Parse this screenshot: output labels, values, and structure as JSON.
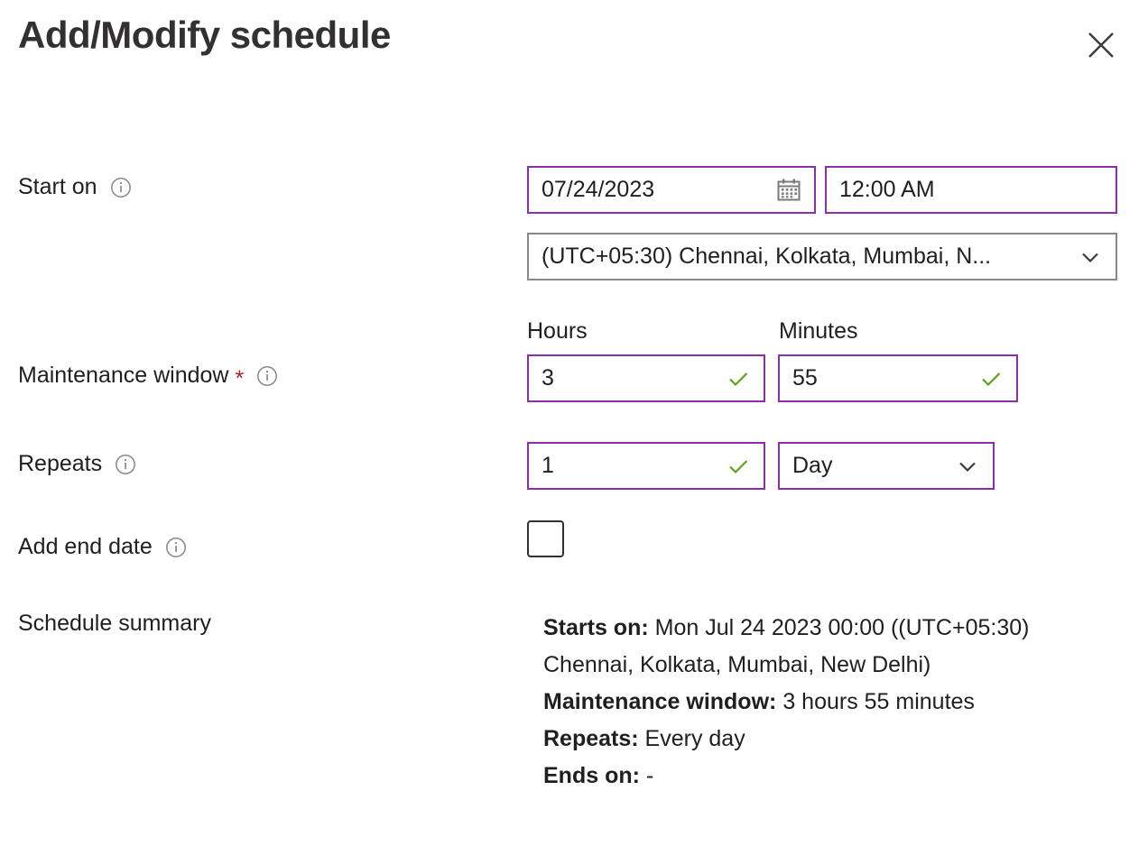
{
  "panel": {
    "title": "Add/Modify schedule",
    "close_label": "Close",
    "close_icon": "close-icon"
  },
  "form": {
    "start_on": {
      "label": "Start on",
      "info_icon": "info-icon",
      "date_value": "07/24/2023",
      "date_icon": "calendar-icon",
      "time_value": "12:00 AM",
      "timezone_value": "(UTC+05:30) Chennai, Kolkata, Mumbai, N...",
      "timezone_chevron": "chevron-down-icon"
    },
    "maintenance_window": {
      "label": "Maintenance window",
      "required_marker": "*",
      "info_icon": "info-icon",
      "hours_label": "Hours",
      "hours_value": "3",
      "hours_valid_icon": "check-icon",
      "minutes_label": "Minutes",
      "minutes_value": "55",
      "minutes_valid_icon": "check-icon"
    },
    "repeats": {
      "label": "Repeats",
      "info_icon": "info-icon",
      "interval_value": "1",
      "interval_valid_icon": "check-icon",
      "unit_value": "Day",
      "unit_chevron": "chevron-down-icon"
    },
    "add_end_date": {
      "label": "Add end date",
      "info_icon": "info-icon",
      "checked": false
    },
    "schedule_summary": {
      "label": "Schedule summary",
      "lines": [
        {
          "key": "Starts on:",
          "value": "Mon Jul 24 2023 00:00 ((UTC+05:30) Chennai, Kolkata, Mumbai, New Delhi)"
        },
        {
          "key": "Maintenance window:",
          "value": "3 hours 55 minutes"
        },
        {
          "key": "Repeats:",
          "value": "Every day"
        },
        {
          "key": "Ends on:",
          "value": "-"
        }
      ]
    }
  },
  "colors": {
    "accent_purple": "#8b2fa8",
    "neutral_border": "#8a8886",
    "valid_green": "#5aa21a",
    "required_red": "#a4262c",
    "text": "#201f1e",
    "title": "#323130"
  }
}
